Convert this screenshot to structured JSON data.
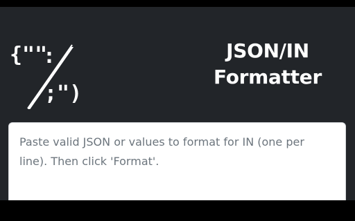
{
  "header": {
    "logo_icon": "json-braces-slash-icon",
    "title_line1": "JSON/IN",
    "title_line2": "Formatter"
  },
  "input": {
    "value": "",
    "placeholder": "Paste valid JSON or values to format for IN (one per line). Then click 'Format'."
  },
  "colors": {
    "background": "#222529",
    "frame": "#000000",
    "text_light": "#ffffff",
    "placeholder": "#6c757d",
    "editor_bg": "#ffffff"
  }
}
